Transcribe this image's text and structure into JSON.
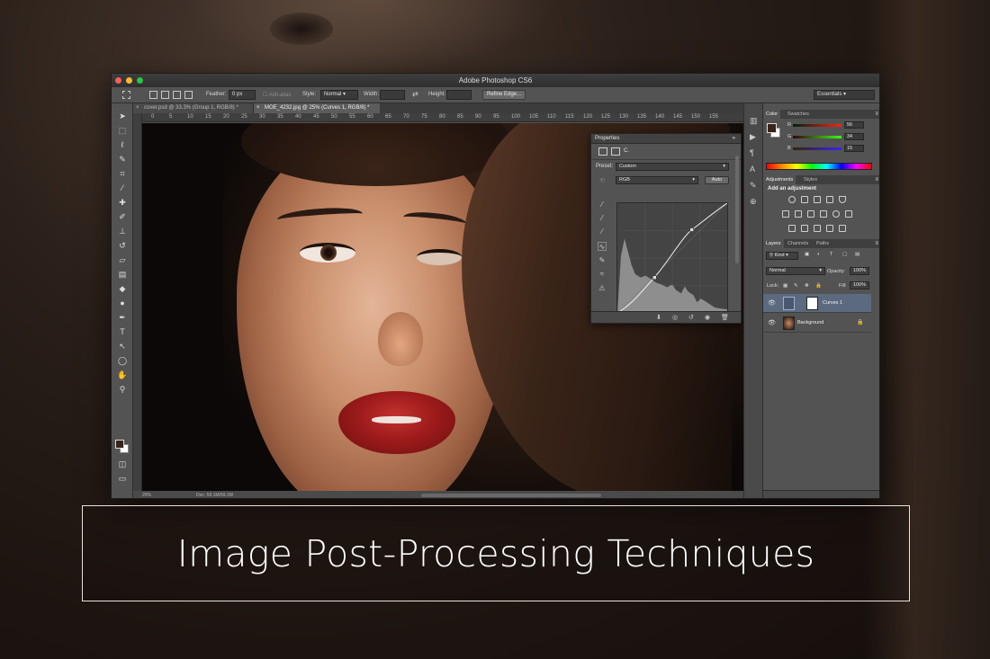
{
  "app": {
    "window_title": "Adobe Photoshop CS6"
  },
  "options_bar": {
    "feather_label": "Feather:",
    "feather_value": "0 px",
    "anti_alias_label": "Anti-alias",
    "style_label": "Style:",
    "style_value": "Normal",
    "width_label": "Width:",
    "height_label": "Height:",
    "refine_edge_label": "Refine Edge...",
    "workspace_value": "Essentials"
  },
  "document_tabs": [
    {
      "label": "cover.psd @ 33.3% (Group 1, RGB/8) *",
      "active": false
    },
    {
      "label": "MOE_4232.jpg @ 25% (Curves 1, RGB/8) *",
      "active": true
    }
  ],
  "ruler": {
    "ticks": [
      "0",
      "5",
      "10",
      "15",
      "20",
      "25",
      "30",
      "35",
      "40",
      "45",
      "50",
      "55",
      "60",
      "65",
      "70",
      "75",
      "80",
      "85",
      "90",
      "95",
      "100",
      "105",
      "110",
      "115",
      "120",
      "125",
      "130",
      "135",
      "140",
      "145",
      "150",
      "155"
    ]
  },
  "status_bar": {
    "zoom": "25%",
    "doc_size": "Doc: 59.1M/59.1M"
  },
  "properties_panel": {
    "title": "Properties",
    "header_label": "C.",
    "preset_label": "Preset:",
    "preset_value": "Custom",
    "channel_value": "RGB",
    "auto_label": "Auto"
  },
  "color_panel": {
    "tabs": [
      "Color",
      "Swatches"
    ],
    "r_label": "R",
    "g_label": "G",
    "b_label": "B",
    "r_value": "56",
    "g_value": "34",
    "b_value": "15",
    "fg_color": "#38221b",
    "bg_color": "#ffffff"
  },
  "adjustments_panel": {
    "tabs": [
      "Adjustments",
      "Styles"
    ],
    "title": "Add an adjustment"
  },
  "layers_panel": {
    "tabs": [
      "Layers",
      "Channels",
      "Paths"
    ],
    "kind_label": "Kind",
    "blend_mode": "Normal",
    "opacity_label": "Opacity:",
    "opacity_value": "100%",
    "lock_label": "Lock:",
    "fill_label": "Fill:",
    "fill_value": "100%",
    "layers": [
      {
        "name": "Curves 1",
        "selected": true
      },
      {
        "name": "Background",
        "selected": false
      }
    ]
  },
  "caption": {
    "title": "Image Post-Processing Techniques"
  },
  "colors": {
    "accent_selected_layer": "#5c6a80",
    "lip_red": "#9e1b1b",
    "panel_gray": "#535353"
  }
}
